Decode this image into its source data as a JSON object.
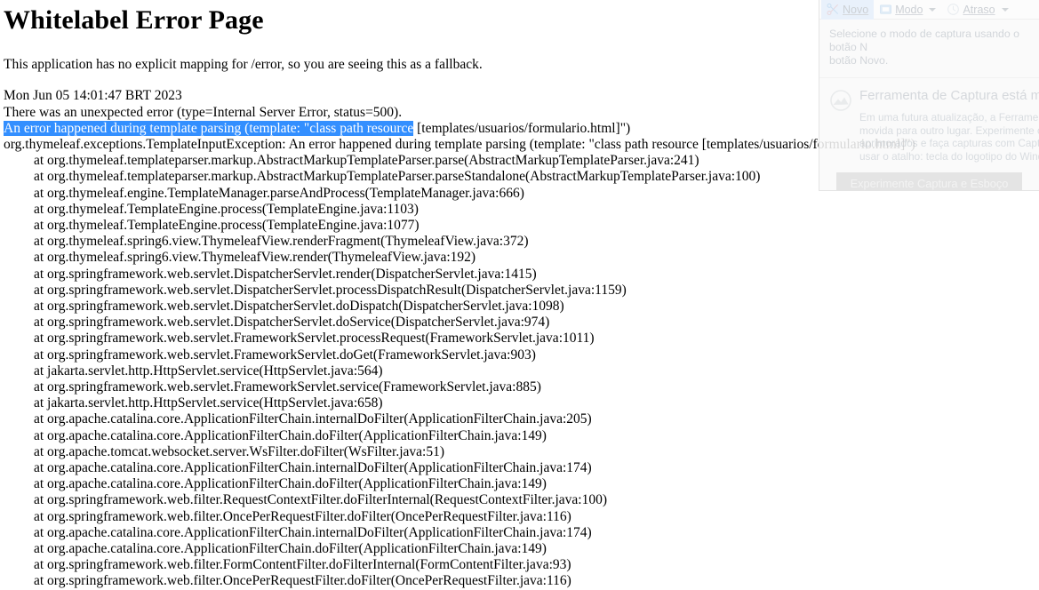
{
  "error_page": {
    "title": "Whitelabel Error Page",
    "fallback_message": "This application has no explicit mapping for /error, so you are seeing this as a fallback.",
    "timestamp": "Mon Jun 05 14:01:47 BRT 2023",
    "status_message": "There was an unexpected error (type=Internal Server Error, status=500).",
    "message_selected": "An error happened during template parsing (template: \"class path resource",
    "message_unselected": " [templates/usuarios/formulario.html]\")",
    "selection_color": "#338fff",
    "selection_text_color": "#ffffff",
    "exception_line": "org.thymeleaf.exceptions.TemplateInputException: An error happened during template parsing (template: \"class path resource [templates/usuarios/formulario.html]\")",
    "stack_trace": [
      "at org.thymeleaf.templateparser.markup.AbstractMarkupTemplateParser.parse(AbstractMarkupTemplateParser.java:241)",
      "at org.thymeleaf.templateparser.markup.AbstractMarkupTemplateParser.parseStandalone(AbstractMarkupTemplateParser.java:100)",
      "at org.thymeleaf.engine.TemplateManager.parseAndProcess(TemplateManager.java:666)",
      "at org.thymeleaf.TemplateEngine.process(TemplateEngine.java:1103)",
      "at org.thymeleaf.TemplateEngine.process(TemplateEngine.java:1077)",
      "at org.thymeleaf.spring6.view.ThymeleafView.renderFragment(ThymeleafView.java:372)",
      "at org.thymeleaf.spring6.view.ThymeleafView.render(ThymeleafView.java:192)",
      "at org.springframework.web.servlet.DispatcherServlet.render(DispatcherServlet.java:1415)",
      "at org.springframework.web.servlet.DispatcherServlet.processDispatchResult(DispatcherServlet.java:1159)",
      "at org.springframework.web.servlet.DispatcherServlet.doDispatch(DispatcherServlet.java:1098)",
      "at org.springframework.web.servlet.DispatcherServlet.doService(DispatcherServlet.java:974)",
      "at org.springframework.web.servlet.FrameworkServlet.processRequest(FrameworkServlet.java:1011)",
      "at org.springframework.web.servlet.FrameworkServlet.doGet(FrameworkServlet.java:903)",
      "at jakarta.servlet.http.HttpServlet.service(HttpServlet.java:564)",
      "at org.springframework.web.servlet.FrameworkServlet.service(FrameworkServlet.java:885)",
      "at jakarta.servlet.http.HttpServlet.service(HttpServlet.java:658)",
      "at org.apache.catalina.core.ApplicationFilterChain.internalDoFilter(ApplicationFilterChain.java:205)",
      "at org.apache.catalina.core.ApplicationFilterChain.doFilter(ApplicationFilterChain.java:149)",
      "at org.apache.tomcat.websocket.server.WsFilter.doFilter(WsFilter.java:51)",
      "at org.apache.catalina.core.ApplicationFilterChain.internalDoFilter(ApplicationFilterChain.java:174)",
      "at org.apache.catalina.core.ApplicationFilterChain.doFilter(ApplicationFilterChain.java:149)",
      "at org.springframework.web.filter.RequestContextFilter.doFilterInternal(RequestContextFilter.java:100)",
      "at org.springframework.web.filter.OncePerRequestFilter.doFilter(OncePerRequestFilter.java:116)",
      "at org.apache.catalina.core.ApplicationFilterChain.internalDoFilter(ApplicationFilterChain.java:174)",
      "at org.apache.catalina.core.ApplicationFilterChain.doFilter(ApplicationFilterChain.java:149)",
      "at org.springframework.web.filter.FormContentFilter.doFilterInternal(FormContentFilter.java:93)",
      "at org.springframework.web.filter.OncePerRequestFilter.doFilter(OncePerRequestFilter.java:116)"
    ]
  },
  "snipping_tool": {
    "toolbar": {
      "new_label": "Novo",
      "mode_label": "Modo",
      "delay_label": "Atraso"
    },
    "hint_line1": "Selecione o modo de captura usando o botão N",
    "hint_line2": "botão Novo.",
    "promo_heading": "Ferramenta de Captura está m",
    "promo_lines": [
      "Em uma futura atualização, a Ferramenta",
      "movida para outro lugar. Experimente os",
      "aprimorados e faça capturas com Captur",
      "usar o atalho: tecla do logotipo do Wind"
    ],
    "cta_label": "Experimente Captura e Esboço"
  }
}
